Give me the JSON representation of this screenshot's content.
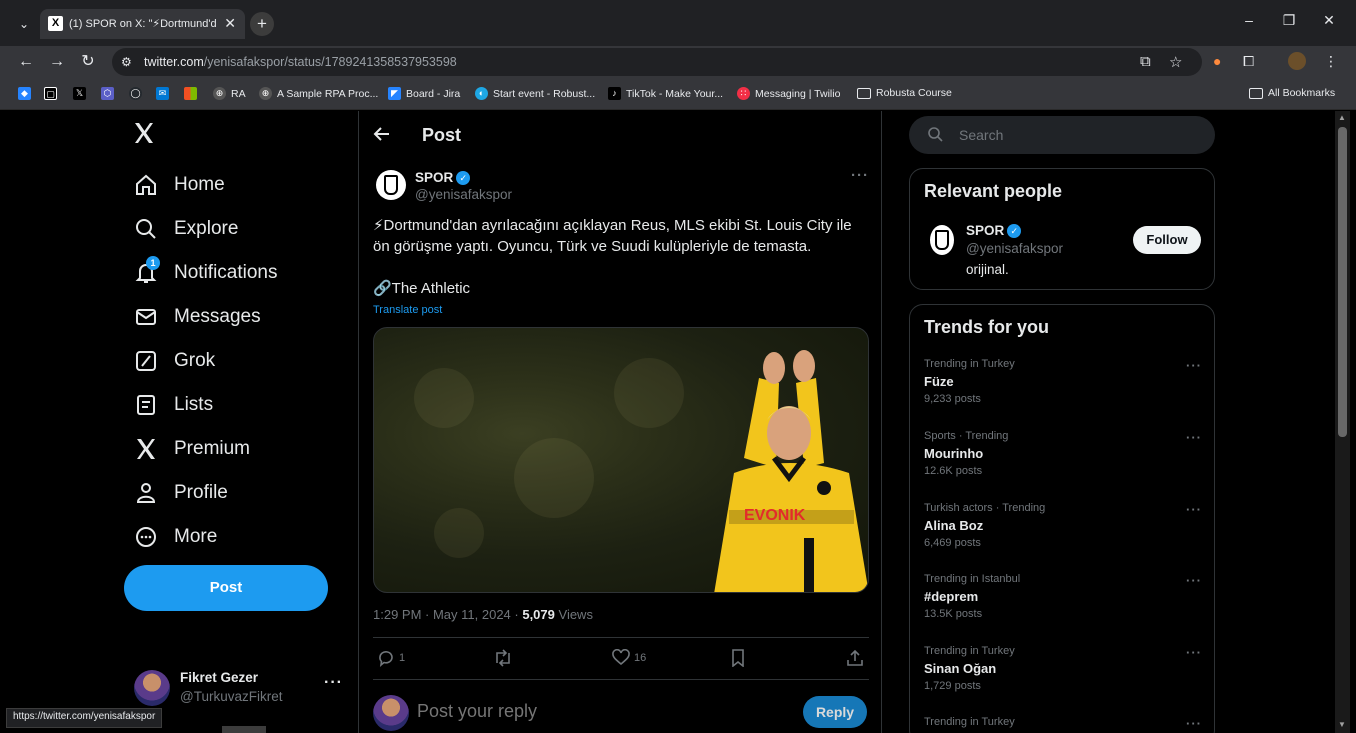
{
  "browser": {
    "tab_title": "(1) SPOR on X: \"⚡Dortmund'd",
    "url_domain": "twitter.com",
    "url_path": "/yenisafakspor/status/1789241358537953598",
    "bookmarks": [
      {
        "label": "",
        "icon": "jira-diamond-icon"
      },
      {
        "label": "",
        "icon": "square-icon"
      },
      {
        "label": "",
        "icon": "x-logo-icon"
      },
      {
        "label": "",
        "icon": "hexagon-icon"
      },
      {
        "label": "",
        "icon": "github-icon"
      },
      {
        "label": "",
        "icon": "outlook-icon"
      },
      {
        "label": "",
        "icon": "microsoft-icon"
      },
      {
        "label": "RA",
        "icon": "globe-icon"
      },
      {
        "label": "A Sample RPA Proc...",
        "icon": "globe-icon"
      },
      {
        "label": "Board - Jira",
        "icon": "jira-icon"
      },
      {
        "label": "Start event - Robust...",
        "icon": "robust-icon"
      },
      {
        "label": "TikTok - Make Your...",
        "icon": "tiktok-icon"
      },
      {
        "label": "Messaging | Twilio",
        "icon": "twilio-icon"
      },
      {
        "label": "Robusta Course",
        "icon": "folder-icon"
      }
    ],
    "all_bookmarks": "All Bookmarks",
    "status_url": "https://twitter.com/yenisafakspor"
  },
  "nav": {
    "items": [
      {
        "label": "Home",
        "icon": "home-icon"
      },
      {
        "label": "Explore",
        "icon": "search-icon"
      },
      {
        "label": "Notifications",
        "icon": "bell-icon",
        "badge": "1"
      },
      {
        "label": "Messages",
        "icon": "envelope-icon"
      },
      {
        "label": "Grok",
        "icon": "grok-icon"
      },
      {
        "label": "Lists",
        "icon": "list-icon"
      },
      {
        "label": "Premium",
        "icon": "x-logo-icon"
      },
      {
        "label": "Profile",
        "icon": "person-icon"
      },
      {
        "label": "More",
        "icon": "more-circle-icon"
      }
    ],
    "post_button": "Post",
    "me": {
      "name": "Fikret Gezer",
      "handle": "@TurkuvazFikret"
    }
  },
  "post": {
    "page_title": "Post",
    "author_name": "SPOR",
    "author_handle": "@yenisafakspor",
    "text_line1": "⚡Dortmund'dan ayrılacağını açıklayan Reus, MLS ekibi St. Louis City ile ön görüşme yaptı. Oyuncu, Türk ve Suudi kulüpleriyle de temasta.",
    "source_line": "🔗The Athletic",
    "translate": "Translate post",
    "time": "1:29 PM · May 11, 2024 · ",
    "views_count": "5,079",
    "views_label": " Views",
    "replies": "1",
    "likes": "16",
    "reply_placeholder": "Post your reply",
    "reply_button": "Reply"
  },
  "search": {
    "placeholder": "Search"
  },
  "relevant": {
    "title": "Relevant people",
    "name": "SPOR",
    "handle": "@yenisafakspor",
    "bio": "orijinal.",
    "follow": "Follow"
  },
  "trends": {
    "title": "Trends for you",
    "items": [
      {
        "context": "Trending in Turkey",
        "name": "Füze",
        "count": "9,233 posts"
      },
      {
        "context": "Sports · Trending",
        "name": "Mourinho",
        "count": "12.6K posts"
      },
      {
        "context": "Turkish actors · Trending",
        "name": "Alina Boz",
        "count": "6,469 posts"
      },
      {
        "context": "Trending in Istanbul",
        "name": "#deprem",
        "count": "13.5K posts"
      },
      {
        "context": "Trending in Turkey",
        "name": "Sinan Oğan",
        "count": "1,729 posts"
      },
      {
        "context": "Trending in Turkey",
        "name": "",
        "count": ""
      }
    ]
  },
  "colors": {
    "accent": "#1d9bf0",
    "background": "#000000",
    "muted": "#71767b"
  }
}
